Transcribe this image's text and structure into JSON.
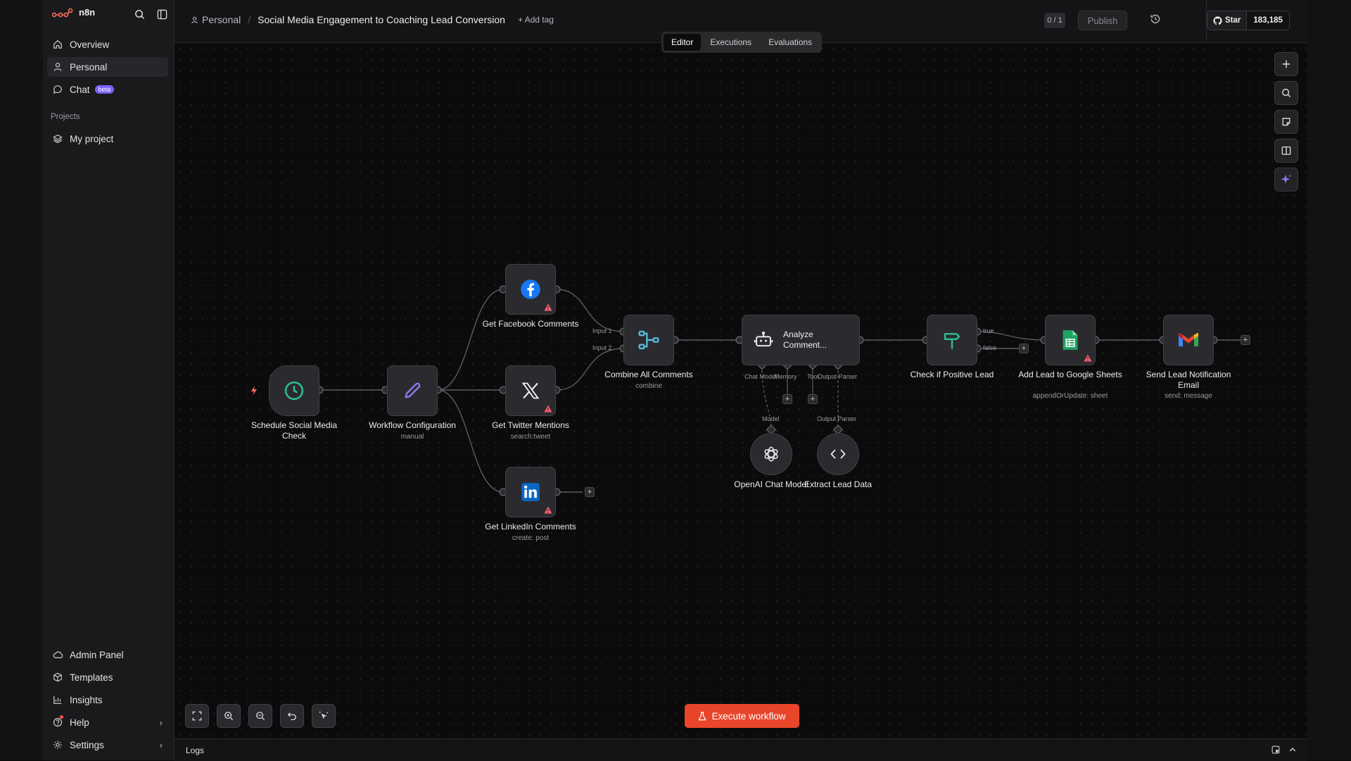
{
  "app": {
    "name": "n8n",
    "brand_color": "#ff6d5a"
  },
  "sidebar": {
    "top_items": [
      {
        "label": "Overview",
        "icon": "home-icon"
      },
      {
        "label": "Personal",
        "icon": "user-icon",
        "active": true
      },
      {
        "label": "Chat",
        "icon": "chat-icon",
        "badge": "beta"
      }
    ],
    "projects_heading": "Projects",
    "projects": [
      {
        "label": "My project",
        "icon": "layers-icon"
      }
    ],
    "bottom_items": [
      {
        "label": "Admin Panel",
        "icon": "cloud-icon"
      },
      {
        "label": "Templates",
        "icon": "box-icon"
      },
      {
        "label": "Insights",
        "icon": "bar-chart-icon"
      },
      {
        "label": "Help",
        "icon": "help-icon"
      },
      {
        "label": "Settings",
        "icon": "gear-icon"
      }
    ]
  },
  "header": {
    "breadcrumb_project": "Personal",
    "breadcrumb_separator": "/",
    "workflow_title": "Social Media Engagement to Coaching Lead Conversion",
    "add_tag": "+ Add tag",
    "version_badge": "0 / 1",
    "publish_label": "Publish",
    "github_star_label": "Star",
    "github_star_count": "183,185"
  },
  "tabs": [
    {
      "label": "Editor",
      "active": true
    },
    {
      "label": "Executions"
    },
    {
      "label": "Evaluations"
    }
  ],
  "nodes": {
    "schedule": {
      "label": "Schedule Social Media Check",
      "icon": "clock-icon"
    },
    "config": {
      "label": "Workflow Configuration",
      "sub": "manual",
      "icon": "pencil-icon"
    },
    "facebook": {
      "label": "Get Facebook Comments",
      "icon": "facebook-icon"
    },
    "twitter": {
      "label": "Get Twitter Mentions",
      "sub": "search:tweet",
      "icon": "x-icon"
    },
    "linkedin": {
      "label": "Get LinkedIn Comments",
      "sub": "create: post",
      "icon": "linkedin-icon"
    },
    "merge": {
      "label": "Combine All Comments",
      "sub": "combine",
      "icon": "merge-icon",
      "input1": "Input 1",
      "input2": "Input 2"
    },
    "agent": {
      "label": "Analyze Comment...",
      "icon": "robot-icon",
      "port_chat_model": "Chat Model",
      "port_memory": "Memory",
      "port_tool": "Tool",
      "port_output_parser": "Output Parser"
    },
    "openai": {
      "label": "OpenAI Chat Model",
      "port": "Model",
      "icon": "openai-icon"
    },
    "parser": {
      "label": "Extract Lead Data",
      "port": "Output Parser",
      "icon": "code-icon"
    },
    "if": {
      "label": "Check if Positive Lead",
      "true_label": "true",
      "false_label": "false",
      "icon": "signpost-icon"
    },
    "sheets": {
      "label": "Add Lead to Google Sheets",
      "sub": "appendOrUpdate: sheet",
      "icon": "google-sheets-icon"
    },
    "gmail": {
      "label": "Send Lead Notification Email",
      "sub": "send: message",
      "icon": "gmail-icon"
    }
  },
  "execute_button": "Execute workflow",
  "logs_label": "Logs"
}
